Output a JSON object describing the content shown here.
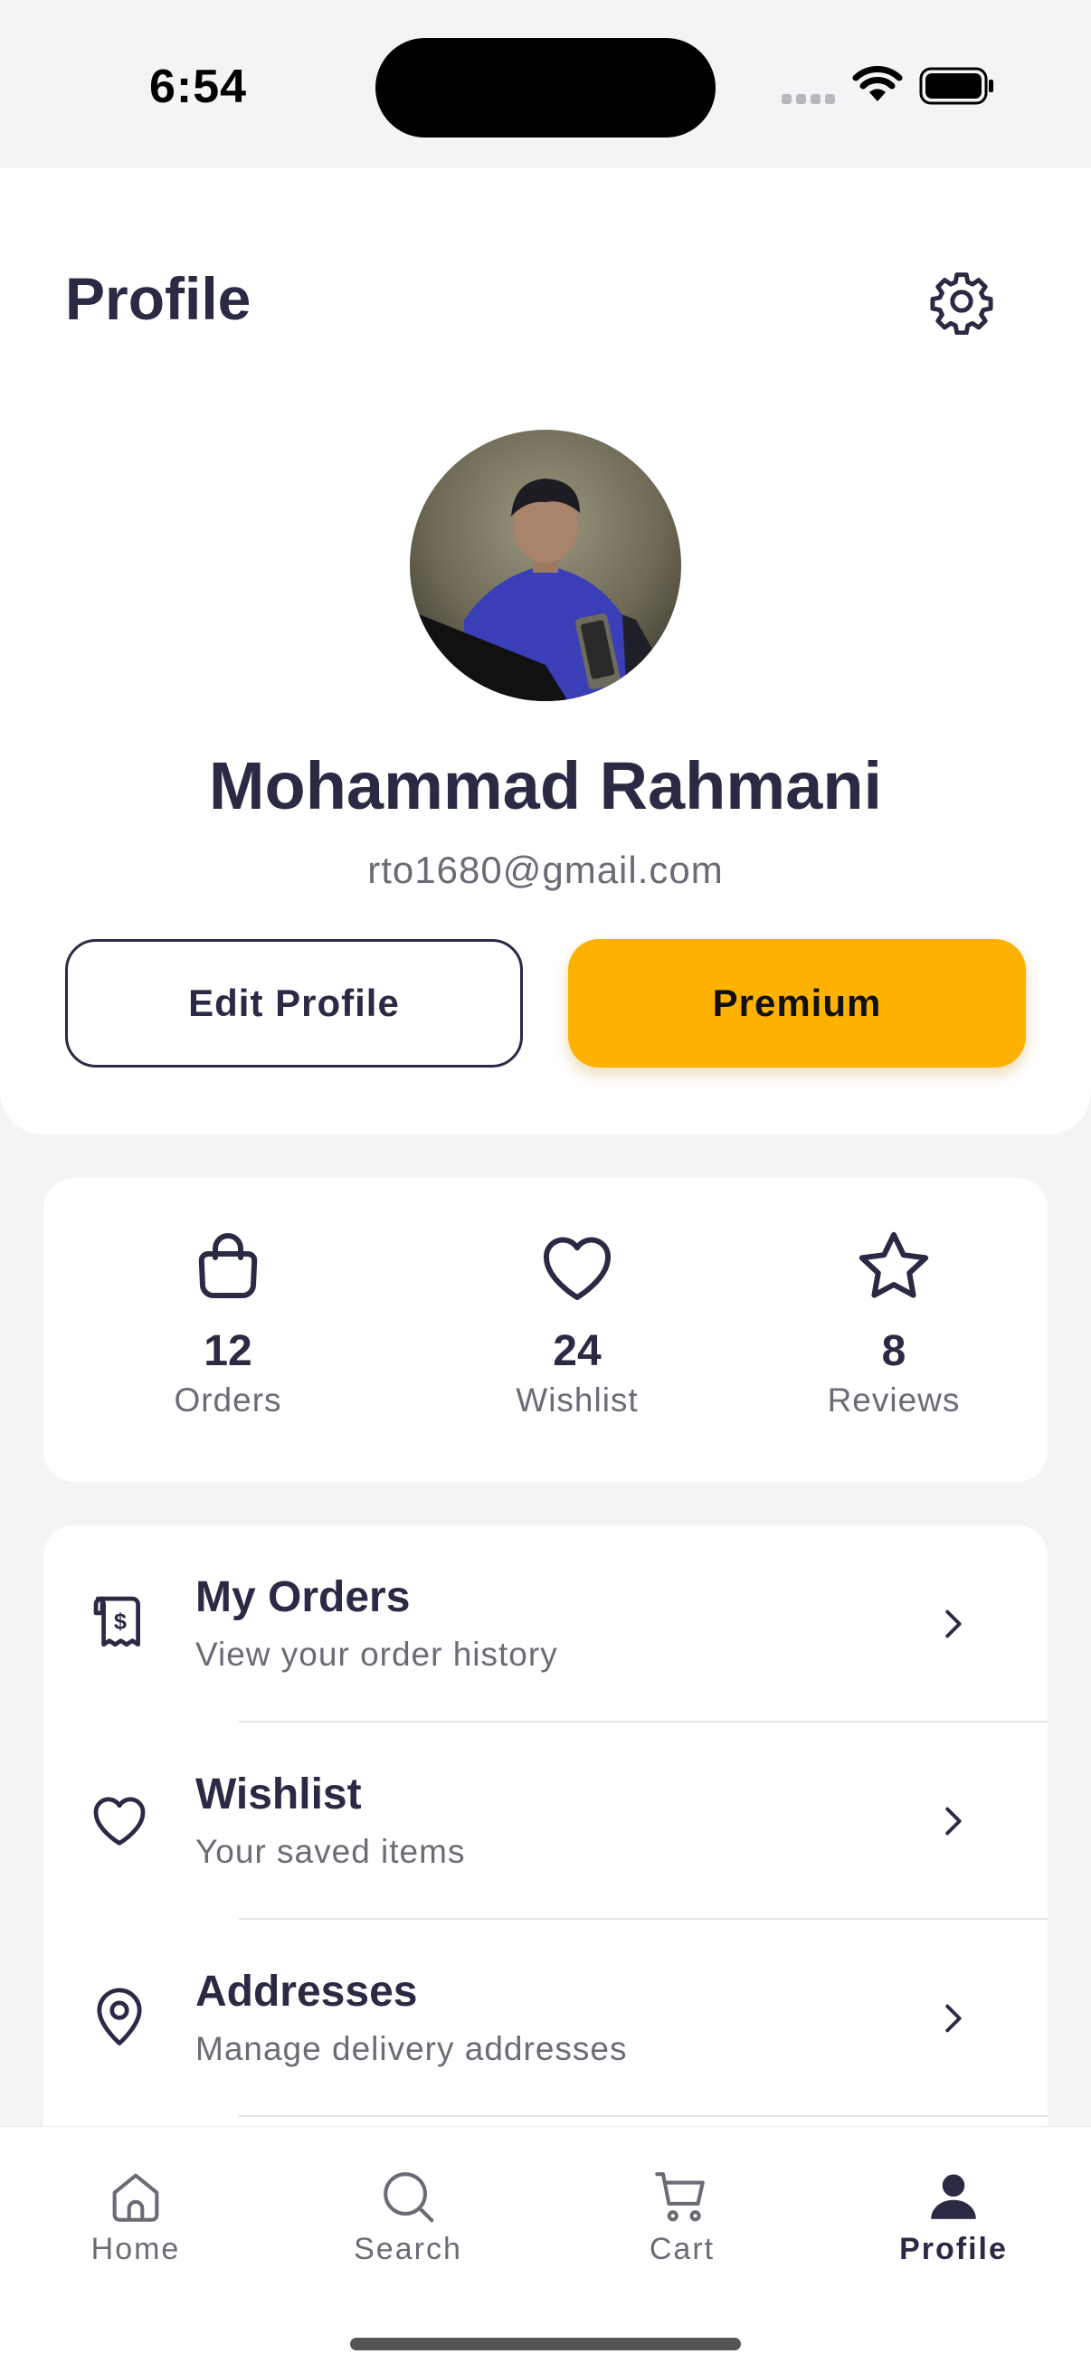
{
  "status_bar": {
    "time": "6:54"
  },
  "header": {
    "title": "Profile",
    "settings_icon": "gear-icon"
  },
  "profile": {
    "name": "Mohammad Rahmani",
    "email": "rto1680@gmail.com",
    "edit_label": "Edit Profile",
    "premium_label": "Premium"
  },
  "stats": [
    {
      "icon": "shopping-bag-icon",
      "value": "12",
      "label": "Orders"
    },
    {
      "icon": "heart-icon",
      "value": "24",
      "label": "Wishlist"
    },
    {
      "icon": "star-icon",
      "value": "8",
      "label": "Reviews"
    }
  ],
  "menu": [
    {
      "icon": "receipt-dollar-icon",
      "title": "My Orders",
      "subtitle": "View your order history"
    },
    {
      "icon": "heart-icon",
      "title": "Wishlist",
      "subtitle": "Your saved items"
    },
    {
      "icon": "map-pin-icon",
      "title": "Addresses",
      "subtitle": "Manage delivery addresses"
    }
  ],
  "tabs": [
    {
      "icon": "home-icon",
      "label": "Home"
    },
    {
      "icon": "search-icon",
      "label": "Search"
    },
    {
      "icon": "cart-icon",
      "label": "Cart"
    },
    {
      "icon": "user-icon",
      "label": "Profile",
      "active": true
    }
  ],
  "colors": {
    "accent": "#FDB201",
    "text_primary": "#2B2A44",
    "text_secondary": "#6B6B76",
    "background": "#F4F4F6"
  }
}
